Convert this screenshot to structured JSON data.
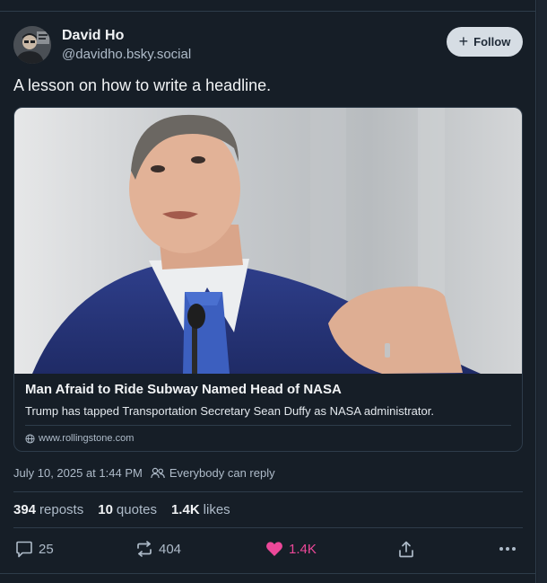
{
  "author": {
    "name": "David Ho",
    "handle": "@davidho.bsky.social",
    "avatar_icon": "avatar-photo"
  },
  "follow": {
    "label": "Follow",
    "icon": "plus-icon"
  },
  "post": {
    "text": "A lesson on how to write a headline."
  },
  "link_card": {
    "title": "Man Afraid to Ride Subway Named Head of NASA",
    "description": "Trump has tapped Transportation Secretary Sean Duffy as NASA administrator.",
    "domain": "www.rollingstone.com",
    "image_desc_icon": "news-photo"
  },
  "meta": {
    "timestamp": "July 10, 2025 at 1:44 PM",
    "reply_setting": "Everybody can reply"
  },
  "stats": {
    "reposts_count": "394",
    "reposts_label": "reposts",
    "quotes_count": "10",
    "quotes_label": "quotes",
    "likes_count": "1.4K",
    "likes_label": "likes"
  },
  "actions": {
    "reply_count": "25",
    "repost_count": "404",
    "like_count": "1.4K"
  },
  "colors": {
    "background": "#161e27",
    "border": "#2e3c4a",
    "muted_text": "#aebbc9",
    "like_accent": "#ec4899",
    "follow_bg": "#d6dde4"
  }
}
